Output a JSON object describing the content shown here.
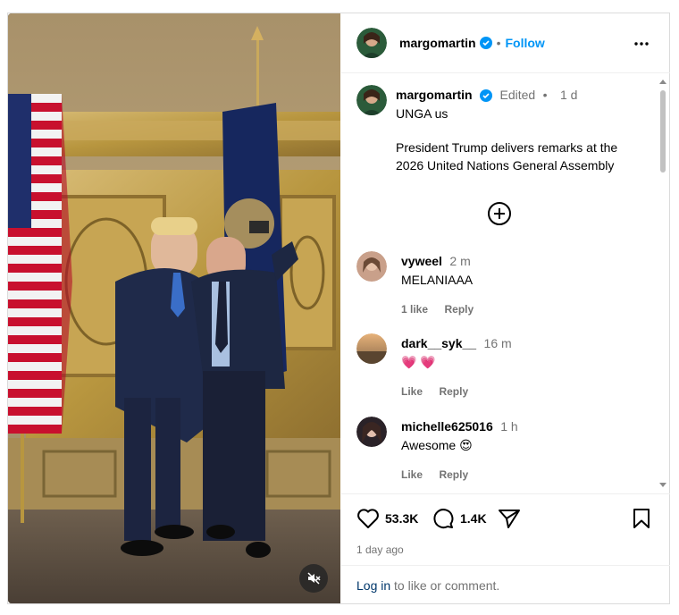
{
  "post": {
    "author": "margomartin",
    "follow_label": "Follow",
    "separator": "•"
  },
  "caption": {
    "username": "margomartin",
    "edited": "Edited",
    "time": "1 d",
    "line1": "UNGA us",
    "line2": "President Trump delivers remarks at the",
    "line3": "2026 United Nations General Assembly"
  },
  "comments": [
    {
      "username": "vyweel",
      "time": "2 m",
      "text": "MELANIAAA",
      "likes": "1 like",
      "reply": "Reply"
    },
    {
      "username": "dark__syk__",
      "time": "16 m",
      "text": "💗 💗",
      "likes": "Like",
      "reply": "Reply"
    },
    {
      "username": "michelle625016",
      "time": "1 h",
      "text": "Awesome 😍",
      "likes": "Like",
      "reply": "Reply"
    }
  ],
  "stats": {
    "likes": "53.3K",
    "comments": "1.4K",
    "date": "1 day ago"
  },
  "login": {
    "link": "Log in",
    "rest": " to like or comment."
  },
  "icons": {
    "verified": "verified-badge-icon",
    "more": "more-options-icon",
    "expand": "plus-circle-icon",
    "like": "heart-icon",
    "comment": "comment-bubble-icon",
    "share": "send-icon",
    "save": "bookmark-icon",
    "mute": "speaker-muted-icon"
  },
  "colors": {
    "accent": "#0095f6",
    "verified": "#0095f6",
    "muted": "#737373",
    "link": "#00376b"
  }
}
